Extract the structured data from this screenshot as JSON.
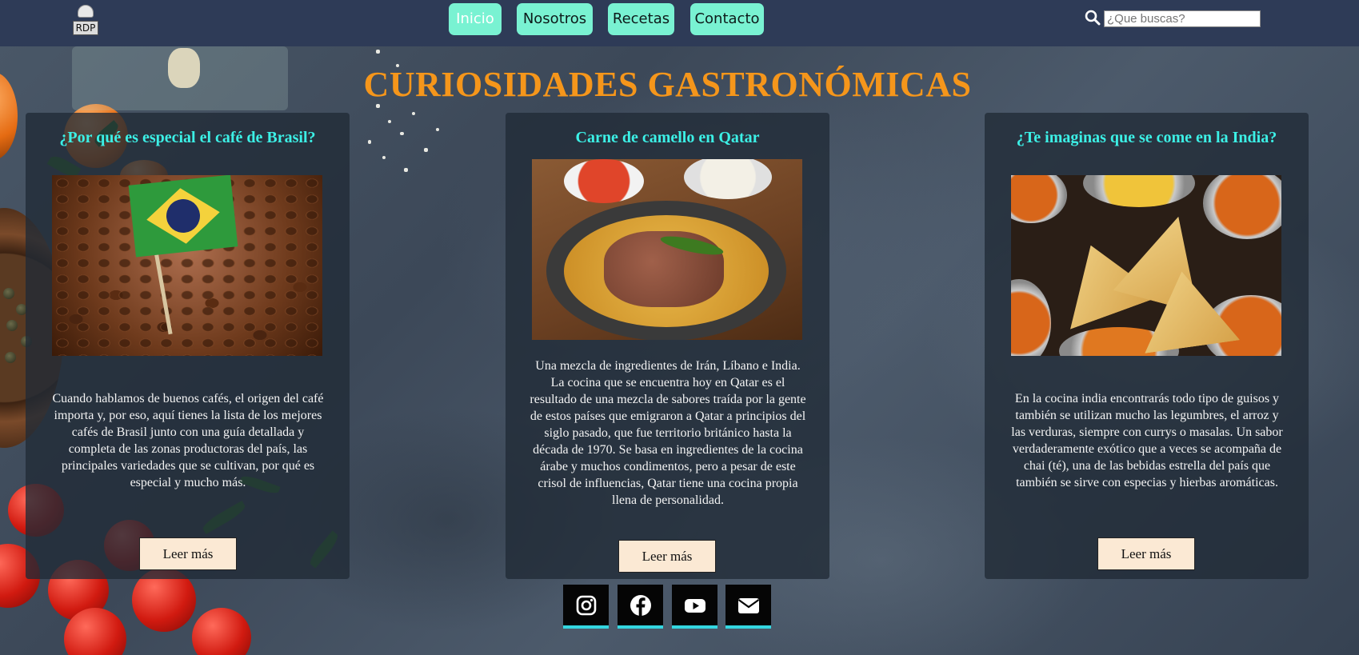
{
  "nav": {
    "logo_text": "RDP",
    "links": [
      {
        "label": "Inicio",
        "active": true
      },
      {
        "label": "Nosotros",
        "active": false
      },
      {
        "label": "Recetas",
        "active": false
      },
      {
        "label": "Contacto",
        "active": false
      }
    ],
    "search_placeholder": "¿Que buscas?",
    "search_icon": "search-icon"
  },
  "page_title": "CURIOSIDADES GASTRONÓMICAS",
  "cards": [
    {
      "title": "¿Por qué es especial el café de Brasil?",
      "image": "coffee-beans-brazil-flag",
      "text": "Cuando hablamos de buenos cafés, el origen del café importa y, por eso, aquí tienes la lista de los mejores cafés de Brasil junto con una guía detallada y completa de las zonas productoras del país, las principales variedades que se cultivan, por qué es especial y mucho más.",
      "button": "Leer más"
    },
    {
      "title": "Carne de camello en Qatar",
      "image": "qatar-camel-dish",
      "text": "Una mezcla de ingredientes de Irán, Líbano e India. La cocina que se encuentra hoy en Qatar es el resultado de una mezcla de sabores traída por la gente de estos países que emigraron a Qatar a principios del siglo pasado, que fue territorio británico hasta la década de 1970. Se basa en ingredientes de la cocina árabe y muchos condimentos, pero a pesar de este crisol de influencias, Qatar tiene una cocina propia llena de personalidad.",
      "button": "Leer más"
    },
    {
      "title": "¿Te imaginas que se come en la India?",
      "image": "indian-samosas-curries",
      "text": "En la cocina india encontrarás todo tipo de guisos y también se utilizan mucho las legumbres, el arroz y las verduras, siempre con currys o masalas. Un sabor verdaderamente exótico que a veces se acompaña de chai (té), una de las bebidas estrella del país que también se sirve con especias y hierbas aromáticas.",
      "button": "Leer más"
    }
  ],
  "social": [
    "instagram-icon",
    "facebook-icon",
    "youtube-icon",
    "email-icon"
  ],
  "colors": {
    "navbar": "#2e3b57",
    "nav_button": "#79f2d2",
    "title": "#f5961b",
    "card_title": "#3cf0e6",
    "read_button": "#fbe9d4",
    "social_accent": "#34d6e0"
  }
}
